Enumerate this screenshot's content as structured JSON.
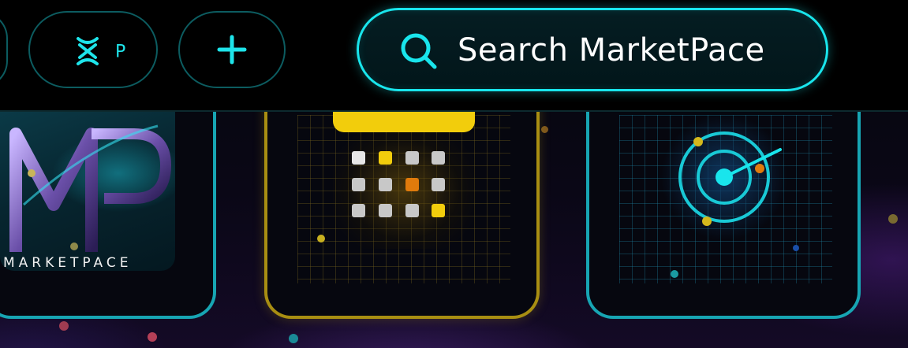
{
  "topbar": {
    "profile_pill": {
      "label": "P",
      "icon": "dna-helix-icon"
    },
    "add_button": {
      "icon": "plus-icon"
    },
    "search": {
      "placeholder": "Search MarketPace",
      "icon": "search-icon"
    }
  },
  "cards": {
    "logo": {
      "monogram": "MP",
      "wordmark": "MARKETPACE"
    },
    "calendar": {
      "icon": "calendar-icon"
    },
    "radar": {
      "icon": "radar-icon"
    }
  },
  "colors": {
    "accent_cyan": "#19e5ec",
    "accent_gold": "#f2cd0c",
    "accent_orange": "#e07b0c",
    "card_border_teal": "#17a5b3",
    "card_border_gold": "#a88e12"
  }
}
